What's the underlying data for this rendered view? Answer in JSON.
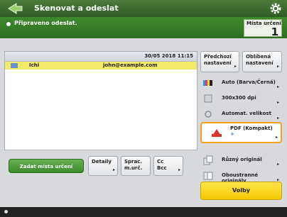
{
  "titlebar": {
    "title": "Skenovat a odeslat"
  },
  "status": {
    "message": "Připraveno odeslat."
  },
  "destinations": {
    "label": "Místa určení",
    "count": "1"
  },
  "list": {
    "timestamp": "30/05 2018 11:15",
    "rows": [
      {
        "name": "Ichi",
        "address": "john@example.com"
      }
    ]
  },
  "bottom": {
    "specify_button": "Zadat místa určení",
    "details_button": "Detaily",
    "sender_button": [
      "Sprac.",
      "m.urč."
    ],
    "cc_button": [
      "Cc",
      "Bcc"
    ]
  },
  "right": {
    "recall_button": [
      "Předchozí",
      "nastavení"
    ],
    "favorites_button": [
      "Oblíbená",
      "nastavení"
    ],
    "settings": [
      {
        "label": "Auto (Barva/Černá)",
        "icon": "color-mode-icon"
      },
      {
        "label": "300x300 dpi",
        "icon": "resolution-icon"
      },
      {
        "label": "Automat. velikost",
        "icon": "size-icon"
      },
      {
        "label": "Různý originál",
        "icon": "mixed-original-icon"
      },
      {
        "label": "Oboustranné originály",
        "icon": "duplex-icon"
      }
    ],
    "file_format": [
      "PDF (Kompakt)",
      "+"
    ],
    "options_button": "Volby"
  }
}
